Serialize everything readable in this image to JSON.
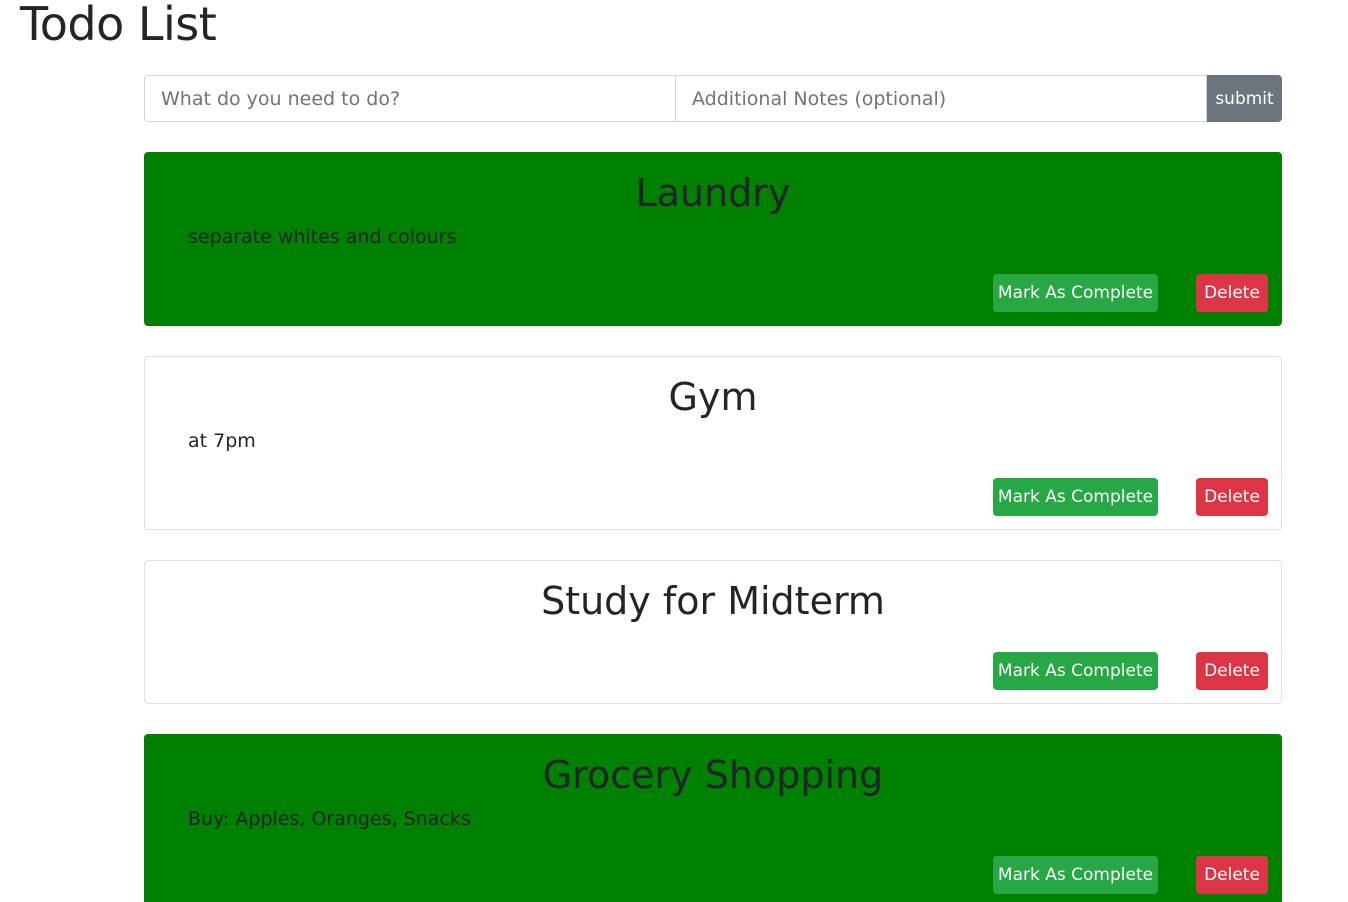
{
  "header": {
    "title": "Todo List"
  },
  "form": {
    "todo_placeholder": "What do you need to do?",
    "notes_placeholder": "Additional Notes (optional)",
    "submit_label": "submit"
  },
  "todos": [
    {
      "title": "Laundry",
      "notes": "separate whites and colours",
      "completed": true,
      "complete_label": "Mark As Complete",
      "delete_label": "Delete"
    },
    {
      "title": "Gym",
      "notes": "at 7pm",
      "completed": false,
      "complete_label": "Mark As Complete",
      "delete_label": "Delete"
    },
    {
      "title": "Study for Midterm",
      "notes": "",
      "completed": false,
      "complete_label": "Mark As Complete",
      "delete_label": "Delete"
    },
    {
      "title": "Grocery Shopping",
      "notes": "Buy: Apples, Oranges, Snacks",
      "completed": true,
      "complete_label": "Mark As Complete",
      "delete_label": "Delete"
    }
  ],
  "colors": {
    "completed_card": "#008000",
    "complete_button": "#28a745",
    "delete_button": "#dc3545",
    "submit_button": "#6c757d"
  }
}
